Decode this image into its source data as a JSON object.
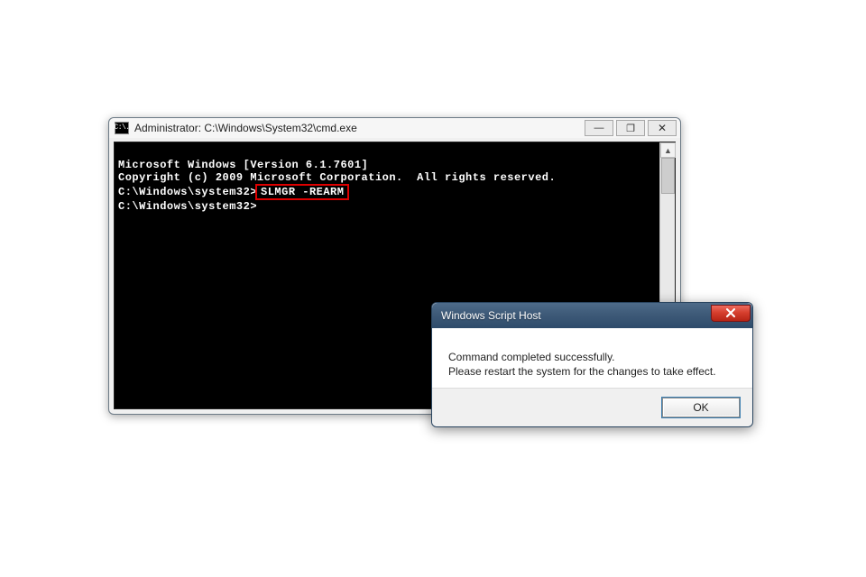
{
  "cmd_window": {
    "icon_text": "C:\\.",
    "title": "Administrator: C:\\Windows\\System32\\cmd.exe",
    "controls": {
      "minimize": "—",
      "maximize": "❐",
      "close": "✕"
    },
    "line_version": "Microsoft Windows [Version 6.1.7601]",
    "line_copyright": "Copyright (c) 2009 Microsoft Corporation.  All rights reserved.",
    "prompt_path": "C:\\Windows\\system32>",
    "command_highlighted": "SLMGR -REARM",
    "blank_line": "",
    "second_prompt": "C:\\Windows\\system32>",
    "scroll_up": "▲",
    "scroll_down": "▼"
  },
  "dialog": {
    "title": "Windows Script Host",
    "body_line1": "Command completed successfully.",
    "body_line2": "Please restart the system for the changes to take effect.",
    "ok_label": "OK"
  }
}
